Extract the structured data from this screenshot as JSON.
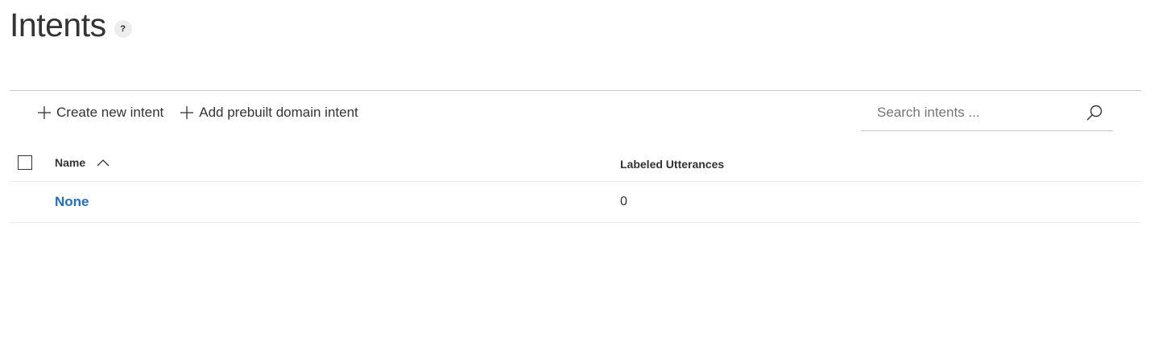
{
  "header": {
    "title": "Intents",
    "help_label": "?"
  },
  "toolbar": {
    "create_label": "Create new intent",
    "add_prebuilt_label": "Add prebuilt domain intent"
  },
  "search": {
    "placeholder": "Search intents ...",
    "value": ""
  },
  "table": {
    "columns": {
      "name": "Name",
      "utterances": "Labeled Utterances"
    },
    "sort": "ascending",
    "rows": [
      {
        "name": "None",
        "utterances": "0"
      }
    ]
  },
  "colors": {
    "link": "#1e6fc8",
    "text": "#333333",
    "divider": "#c8c8c8"
  },
  "icons": [
    "help-icon",
    "plus-icon",
    "search-icon",
    "sort-ascending-icon"
  ]
}
